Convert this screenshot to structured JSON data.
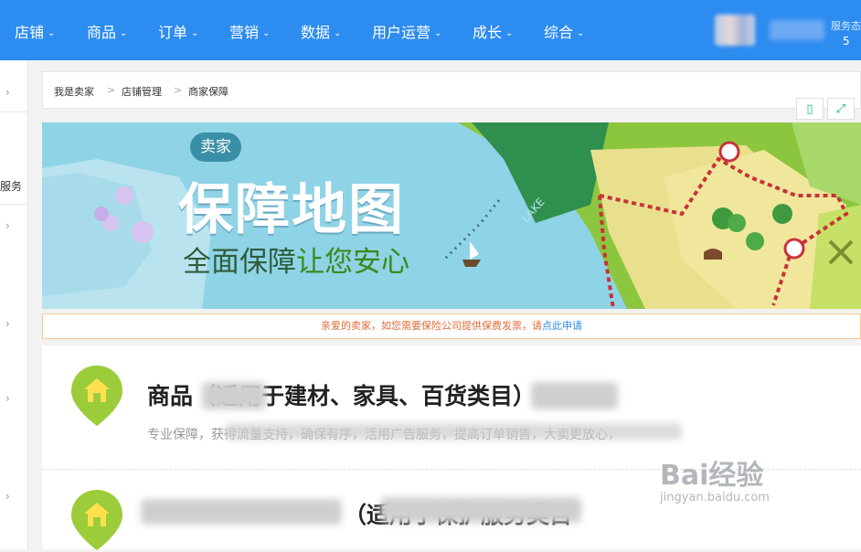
{
  "nav": {
    "items": [
      {
        "label": "店铺"
      },
      {
        "label": "商品"
      },
      {
        "label": "订单"
      },
      {
        "label": "营销"
      },
      {
        "label": "数据"
      },
      {
        "label": "用户运营"
      },
      {
        "label": "成长"
      },
      {
        "label": "综合"
      }
    ],
    "service_label": "服务态",
    "service_value": "5"
  },
  "sidebar": {
    "item_text": "服务"
  },
  "breadcrumb": {
    "items": [
      "我是卖家",
      "店铺管理",
      "商家保障"
    ],
    "separator": ">"
  },
  "banner": {
    "badge": "卖家",
    "title": "保障地图",
    "subtitle_part1": "全面保障",
    "subtitle_part2": "让您安心",
    "lake_label": "LAKE"
  },
  "notice": {
    "text": "亲爱的卖家，如您需要保险公司提供保费发票，请",
    "link": "点此申请"
  },
  "cards": [
    {
      "title": "商品（适用于建材、家具、百货类目）",
      "desc": "专业保障，获得流量支持，确保有序，活用广告服务，提高订单销售，大卖更放心，"
    },
    {
      "title": "（适用于保护服务类目"
    }
  ],
  "watermark": {
    "brand": "Bai经验",
    "url": "jingyan.baidu.com"
  },
  "colors": {
    "nav": "#2d8cf0",
    "accent_green": "#19be6b",
    "notice_text": "#e06c3a",
    "notice_border": "#f3c892"
  }
}
